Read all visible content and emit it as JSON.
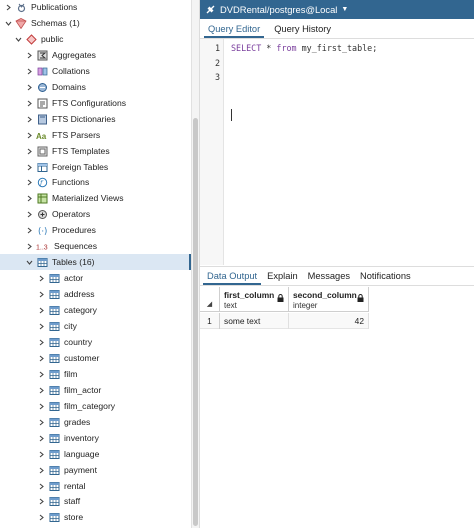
{
  "tree": {
    "items": [
      {
        "label": "Publications",
        "icon": "publication-icon",
        "chevron": "›"
      },
      {
        "label": "Schemas (1)",
        "icon": "schemas-icon",
        "chevron": "⌄"
      },
      {
        "label": "public",
        "icon": "schema-public-icon",
        "chevron": "⌄"
      },
      {
        "label": "Aggregates",
        "icon": "aggregates-icon",
        "chevron": "›"
      },
      {
        "label": "Collations",
        "icon": "collations-icon",
        "chevron": "›"
      },
      {
        "label": "Domains",
        "icon": "domains-icon",
        "chevron": "›"
      },
      {
        "label": "FTS Configurations",
        "icon": "fts-configurations-icon",
        "chevron": "›"
      },
      {
        "label": "FTS Dictionaries",
        "icon": "fts-dictionaries-icon",
        "chevron": "›"
      },
      {
        "label": "FTS Parsers",
        "icon": "fts-parsers-icon",
        "chevron": "›"
      },
      {
        "label": "FTS Templates",
        "icon": "fts-templates-icon",
        "chevron": "›"
      },
      {
        "label": "Foreign Tables",
        "icon": "foreign-tables-icon",
        "chevron": "›"
      },
      {
        "label": "Functions",
        "icon": "functions-icon",
        "chevron": "›"
      },
      {
        "label": "Materialized Views",
        "icon": "materialized-views-icon",
        "chevron": "›"
      },
      {
        "label": "Operators",
        "icon": "operators-icon",
        "chevron": "›"
      },
      {
        "label": "Procedures",
        "icon": "procedures-icon",
        "chevron": "›"
      },
      {
        "label": "Sequences",
        "icon": "sequences-icon",
        "chevron": "›",
        "icon_text": "1..3"
      },
      {
        "label": "Tables (16)",
        "icon": "tables-icon",
        "chevron": "⌄"
      },
      {
        "label": "actor",
        "icon": "table-icon",
        "chevron": "›"
      },
      {
        "label": "address",
        "icon": "table-icon",
        "chevron": "›"
      },
      {
        "label": "category",
        "icon": "table-icon",
        "chevron": "›"
      },
      {
        "label": "city",
        "icon": "table-icon",
        "chevron": "›"
      },
      {
        "label": "country",
        "icon": "table-icon",
        "chevron": "›"
      },
      {
        "label": "customer",
        "icon": "table-icon",
        "chevron": "›"
      },
      {
        "label": "film",
        "icon": "table-icon",
        "chevron": "›"
      },
      {
        "label": "film_actor",
        "icon": "table-icon",
        "chevron": "›"
      },
      {
        "label": "film_category",
        "icon": "table-icon",
        "chevron": "›"
      },
      {
        "label": "grades",
        "icon": "table-icon",
        "chevron": "›"
      },
      {
        "label": "inventory",
        "icon": "table-icon",
        "chevron": "›"
      },
      {
        "label": "language",
        "icon": "table-icon",
        "chevron": "›"
      },
      {
        "label": "payment",
        "icon": "table-icon",
        "chevron": "›"
      },
      {
        "label": "rental",
        "icon": "table-icon",
        "chevron": "›"
      },
      {
        "label": "staff",
        "icon": "table-icon",
        "chevron": "›"
      },
      {
        "label": "store",
        "icon": "table-icon",
        "chevron": "›"
      }
    ],
    "selected_label": "Tables (16)"
  },
  "query_panel": {
    "title": "DVDRental/postgres@Local",
    "tabs": [
      "Query Editor",
      "Query History"
    ],
    "active_tab": "Query Editor",
    "editor": {
      "line_numbers": [
        "1",
        "2",
        "3"
      ],
      "lines": [
        {
          "keyword1": "SELECT",
          "middle": " * ",
          "keyword2": "from",
          "rest": " my_first_table;"
        },
        {
          "keyword1": "",
          "middle": "",
          "keyword2": "",
          "rest": ""
        },
        {
          "keyword1": "",
          "middle": "",
          "keyword2": "",
          "rest": ""
        }
      ]
    }
  },
  "output_panel": {
    "tabs": [
      "Data Output",
      "Explain",
      "Messages",
      "Notifications"
    ],
    "active_tab": "Data Output",
    "columns": [
      {
        "name": "first_column",
        "type": "text"
      },
      {
        "name": "second_column",
        "type": "integer"
      }
    ],
    "rows": [
      {
        "num": "1",
        "cells": [
          "some text",
          "42"
        ]
      }
    ]
  },
  "colors": {
    "accent": "#326690",
    "keyword": "#7a3e9d",
    "selected_row": "#dbe7f3"
  }
}
